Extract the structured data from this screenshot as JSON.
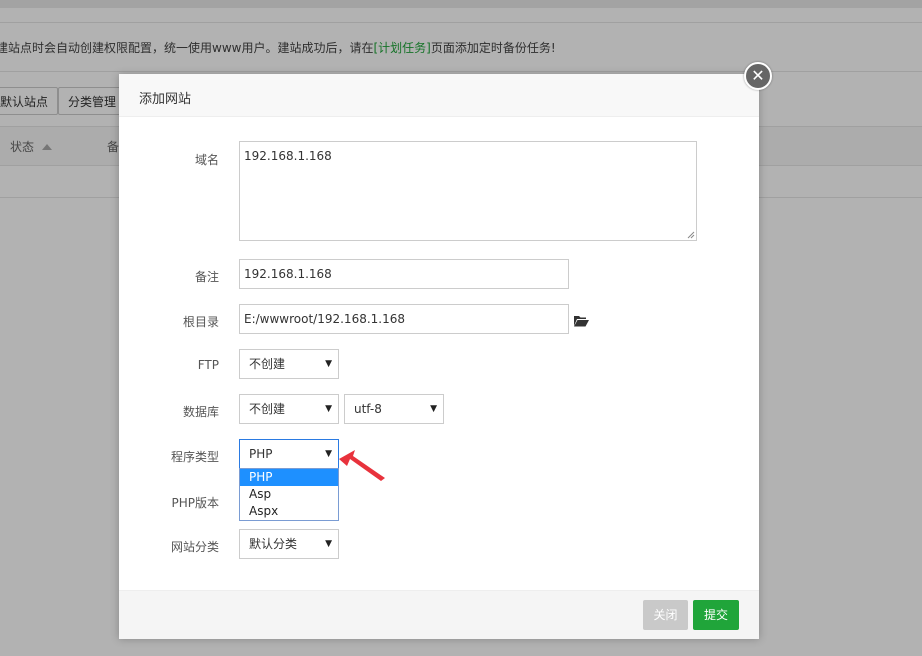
{
  "background": {
    "notice_prefix": "建站点时会自动创建权限配置，统一使用www用户。建站成功后，请在",
    "notice_link": "[计划任务]",
    "notice_suffix": "页面添加定时备份任务!",
    "buttons": [
      "默认站点",
      "分类管理"
    ],
    "columns": [
      "状态",
      "备"
    ]
  },
  "modal": {
    "title": "添加网站",
    "close_icon": "close-icon",
    "fields": {
      "domain": {
        "label": "域名",
        "value": "192.168.1.168"
      },
      "remark": {
        "label": "备注",
        "value": "192.168.1.168"
      },
      "root_dir": {
        "label": "根目录",
        "value": "E:/wwwroot/192.168.1.168",
        "icon": "folder-open-icon"
      },
      "ftp": {
        "label": "FTP",
        "value": "不创建"
      },
      "database": {
        "label": "数据库",
        "value": "不创建",
        "charset": "utf-8"
      },
      "program_type": {
        "label": "程序类型",
        "value": "PHP",
        "options": [
          "PHP",
          "Asp",
          "Aspx"
        ],
        "selected_index": 0
      },
      "php_version": {
        "label": "PHP版本"
      },
      "site_category": {
        "label": "网站分类",
        "value": "默认分类"
      }
    },
    "footer": {
      "close_label": "关闭",
      "submit_label": "提交"
    }
  },
  "colors": {
    "accent_green": "#20a53a",
    "selected_option": "#1e90ff",
    "annotation_arrow": "#e8323c"
  }
}
